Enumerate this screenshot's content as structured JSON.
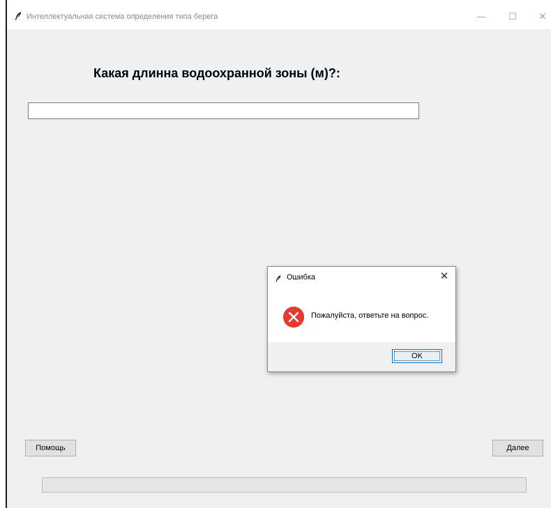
{
  "window": {
    "title": "Интеллектуальная система определения типа берега",
    "minimize_icon": "minimize-icon",
    "maximize_icon": "maximize-icon",
    "close_icon": "close-icon"
  },
  "main": {
    "question": "Какая длинна водоохранной зоны (м)?:",
    "answer": {
      "value": "",
      "placeholder": ""
    },
    "help_label": "Помощь",
    "next_label": "Далее",
    "progress": 0
  },
  "dialog": {
    "title": "Ошибка",
    "message": "Пожалуйста, ответьте на вопрос.",
    "ok_label": "OK",
    "icon": "error-icon",
    "error_color": "#e53a2e"
  }
}
